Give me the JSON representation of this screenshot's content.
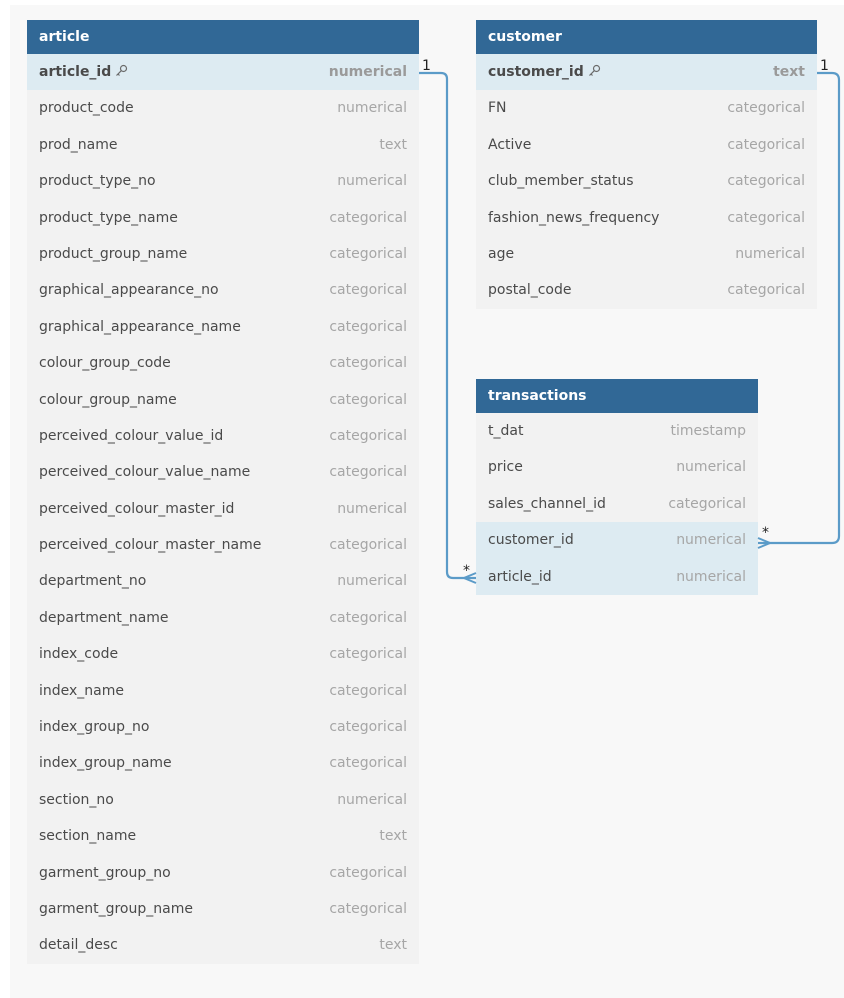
{
  "tables": {
    "article": {
      "name": "article",
      "columns": [
        {
          "name": "article_id",
          "type": "numerical"
        },
        {
          "name": "product_code",
          "type": "numerical"
        },
        {
          "name": "prod_name",
          "type": "text"
        },
        {
          "name": "product_type_no",
          "type": "numerical"
        },
        {
          "name": "product_type_name",
          "type": "categorical"
        },
        {
          "name": "product_group_name",
          "type": "categorical"
        },
        {
          "name": "graphical_appearance_no",
          "type": "categorical"
        },
        {
          "name": "graphical_appearance_name",
          "type": "categorical"
        },
        {
          "name": "colour_group_code",
          "type": "categorical"
        },
        {
          "name": "colour_group_name",
          "type": "categorical"
        },
        {
          "name": "perceived_colour_value_id",
          "type": "categorical"
        },
        {
          "name": "perceived_colour_value_name",
          "type": "categorical"
        },
        {
          "name": "perceived_colour_master_id",
          "type": "numerical"
        },
        {
          "name": "perceived_colour_master_name",
          "type": "categorical"
        },
        {
          "name": "department_no",
          "type": "numerical"
        },
        {
          "name": "department_name",
          "type": "categorical"
        },
        {
          "name": "index_code",
          "type": "categorical"
        },
        {
          "name": "index_name",
          "type": "categorical"
        },
        {
          "name": "index_group_no",
          "type": "categorical"
        },
        {
          "name": "index_group_name",
          "type": "categorical"
        },
        {
          "name": "section_no",
          "type": "numerical"
        },
        {
          "name": "section_name",
          "type": "text"
        },
        {
          "name": "garment_group_no",
          "type": "categorical"
        },
        {
          "name": "garment_group_name",
          "type": "categorical"
        },
        {
          "name": "detail_desc",
          "type": "text"
        }
      ]
    },
    "customer": {
      "name": "customer",
      "columns": [
        {
          "name": "customer_id",
          "type": "text"
        },
        {
          "name": "FN",
          "type": "categorical"
        },
        {
          "name": "Active",
          "type": "categorical"
        },
        {
          "name": "club_member_status",
          "type": "categorical"
        },
        {
          "name": "fashion_news_frequency",
          "type": "categorical"
        },
        {
          "name": "age",
          "type": "numerical"
        },
        {
          "name": "postal_code",
          "type": "categorical"
        }
      ]
    },
    "transactions": {
      "name": "transactions",
      "columns": [
        {
          "name": "t_dat",
          "type": "timestamp"
        },
        {
          "name": "price",
          "type": "numerical"
        },
        {
          "name": "sales_channel_id",
          "type": "categorical"
        },
        {
          "name": "customer_id",
          "type": "numerical"
        },
        {
          "name": "article_id",
          "type": "numerical"
        }
      ]
    }
  },
  "relationships": {
    "article_transactions": {
      "one_label": "1",
      "many_label": "*"
    },
    "customer_transactions": {
      "one_label": "1",
      "many_label": "*"
    }
  },
  "colors": {
    "header": "#316896",
    "key_row": "#ddebf2",
    "body": "#f2f2f2",
    "relationship_line": "#5b9bc8"
  },
  "icons": {
    "primary_key": "key-icon"
  }
}
